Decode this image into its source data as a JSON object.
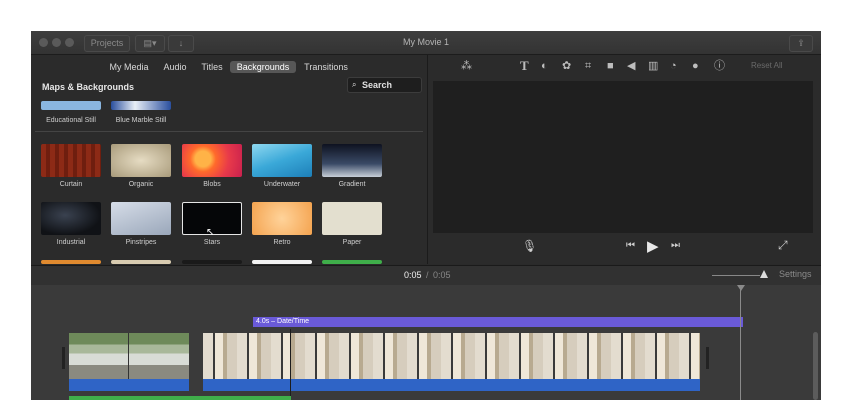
{
  "window": {
    "title": "My Movie 1"
  },
  "toolbar": {
    "projects_label": "Projects"
  },
  "browser": {
    "tabs": [
      {
        "label": "My Media"
      },
      {
        "label": "Audio"
      },
      {
        "label": "Titles"
      },
      {
        "label": "Backgrounds",
        "active": true
      },
      {
        "label": "Transitions"
      }
    ],
    "section_title": "Maps & Backgrounds",
    "search_label": "Search",
    "top_tiles": [
      {
        "label": "Educational Still"
      },
      {
        "label": "Blue Marble Still"
      }
    ],
    "row1": [
      {
        "label": "Curtain"
      },
      {
        "label": "Organic"
      },
      {
        "label": "Blobs"
      },
      {
        "label": "Underwater"
      },
      {
        "label": "Gradient"
      }
    ],
    "row2": [
      {
        "label": "Industrial"
      },
      {
        "label": "Pinstripes"
      },
      {
        "label": "Stars",
        "selected": true
      },
      {
        "label": "Retro"
      },
      {
        "label": "Paper"
      }
    ]
  },
  "viewer": {
    "reset_label": "Reset All"
  },
  "timebar": {
    "current": "0:05",
    "separator": "/",
    "total": "0:05",
    "settings_label": "Settings"
  },
  "timeline": {
    "title_clip_label": "4.0s – Date/Time"
  },
  "colors": {
    "accent_purple": "#6a5ad8",
    "audio_blue": "#2f64c6",
    "green_track": "#3fae4a"
  }
}
